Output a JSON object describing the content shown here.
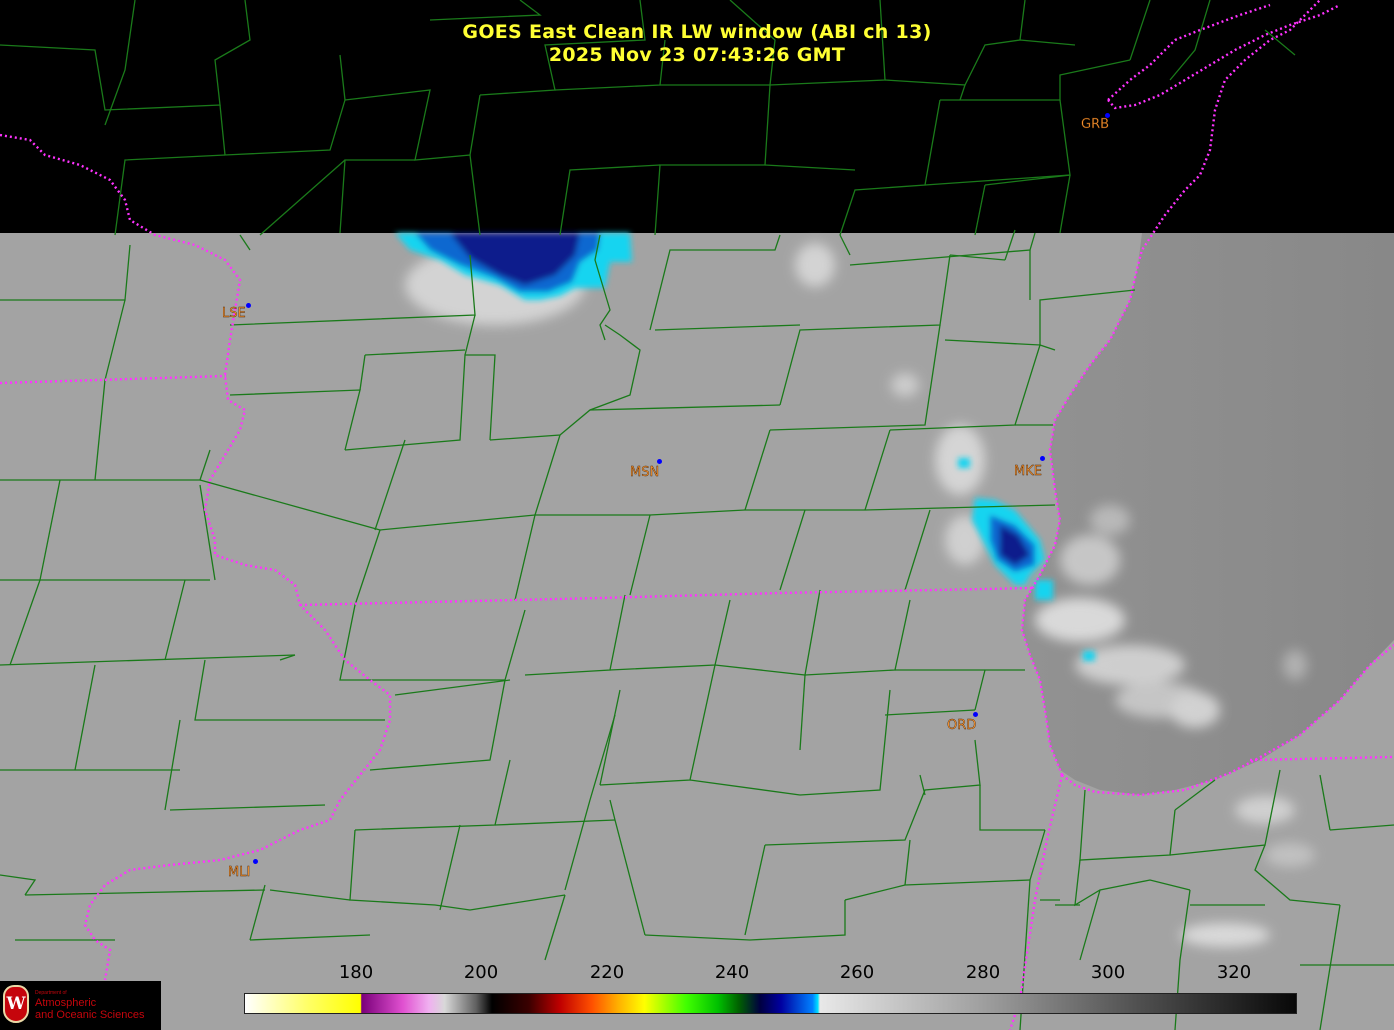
{
  "title": {
    "line1": "GOES East Clean IR LW window (ABI ch 13)",
    "line2": "2025 Nov 23  07:43:26 GMT"
  },
  "stations": [
    {
      "code": "GRB"
    },
    {
      "code": "LSE"
    },
    {
      "code": "MSN"
    },
    {
      "code": "MKE"
    },
    {
      "code": "ORD"
    },
    {
      "code": "MLI"
    }
  ],
  "colorbar": {
    "ticks": [
      "180",
      "200",
      "220",
      "240",
      "260",
      "280",
      "300",
      "320"
    ]
  },
  "logo": {
    "letter": "W",
    "dept": "Department of",
    "line1": "Atmospheric",
    "line2": "and Oceanic Sciences"
  },
  "colors": {
    "title": "#ffff33",
    "station_label": "#ff9a33",
    "county_line": "#1a7a1a",
    "state_border": "#ff33ff",
    "land_gray": "#a3a3a3",
    "lake_gray": "#8f8f8f",
    "cold_cloud_blue": "#0a1e8c",
    "cold_cloud_cyan": "#19d4f0"
  }
}
